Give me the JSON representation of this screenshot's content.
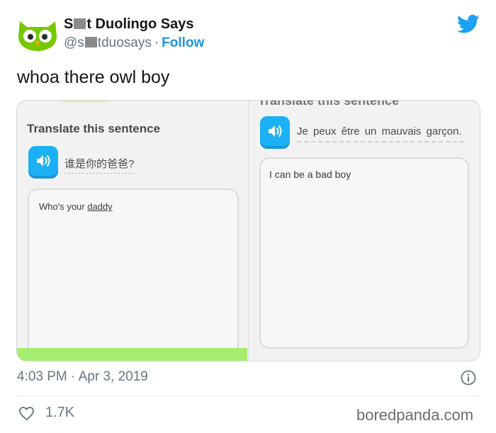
{
  "tweet": {
    "display_name_pre": "S",
    "display_name_post": "t Duolingo Says",
    "handle_pre": "@s",
    "handle_post": "tduosays",
    "dot": "·",
    "follow_label": "Follow",
    "text": "whoa there owl boy",
    "timestamp": "4:03 PM · Apr 3, 2019",
    "likes": "1.7K"
  },
  "media": {
    "left": {
      "title": "Translate this sentence",
      "prompt": "谁是你的爸爸?",
      "answer_pre": "Who's your ",
      "answer_underlined": "daddy"
    },
    "right": {
      "header_cut": "Translate this sentence",
      "prompt": "Je peux être un mauvais garçon.",
      "answer": "I can be a bad boy"
    }
  },
  "watermark": "boredpanda.com",
  "colors": {
    "twitter_blue": "#1da1f2",
    "follow_blue": "#1b95e0",
    "duolingo_speaker": "#1cb0f6",
    "progress_green": "#a5ed6e",
    "owl_green": "#78c800"
  },
  "icons": [
    "duolingo-owl-avatar",
    "twitter-bird-icon",
    "speaker-icon",
    "info-icon",
    "heart-icon"
  ]
}
